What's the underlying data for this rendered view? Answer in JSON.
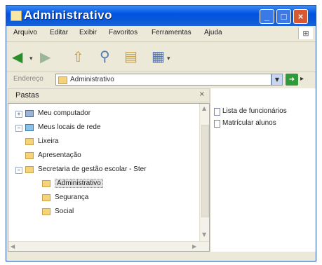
{
  "window": {
    "title": "Administrativo"
  },
  "menu": [
    "Arquivo",
    "Editar",
    "Exibir",
    "Favoritos",
    "Ferramentas",
    "Ajuda"
  ],
  "toolbar": {
    "icons": [
      "back-arrow-icon",
      "forward-arrow-icon",
      "up-folder-icon",
      "search-icon",
      "folders-icon",
      "views-icon"
    ]
  },
  "address": {
    "label": "Endereço",
    "value": "Administrativo"
  },
  "sidebar": {
    "header": "Pastas",
    "close": "×",
    "items": [
      {
        "label": "Meu computador",
        "icon": "computer-icon",
        "expander": "+"
      },
      {
        "label": "Meus locais de rede",
        "icon": "network-icon",
        "expander": "−"
      },
      {
        "label": "Lixeira",
        "icon": "recycle-bin-icon",
        "expander": ""
      },
      {
        "label": "Apresentação",
        "icon": "folder-icon",
        "expander": ""
      },
      {
        "label": "Secretaria de gestão escolar - Ster",
        "icon": "folder-icon",
        "expander": "−"
      },
      {
        "label": "Administrativo",
        "icon": "folder-icon",
        "expander": "",
        "selected": true
      },
      {
        "label": "Segurança",
        "icon": "folder-icon",
        "expander": ""
      },
      {
        "label": "Social",
        "icon": "folder-icon",
        "expander": ""
      }
    ]
  },
  "files": [
    {
      "label": "Lista de funcionários"
    },
    {
      "label": "Matrícular alunos"
    }
  ]
}
